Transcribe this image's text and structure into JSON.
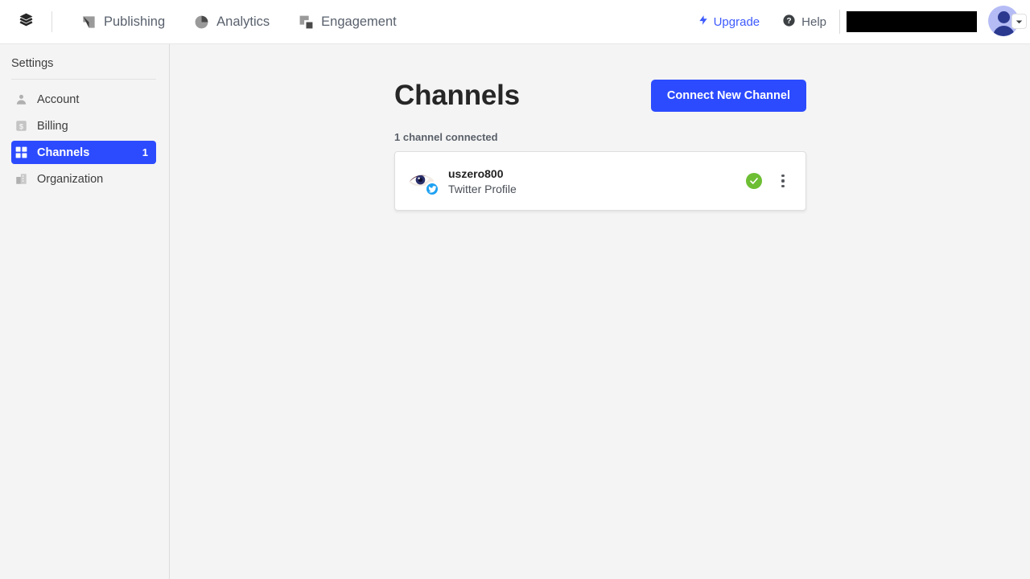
{
  "topbar": {
    "logo_icon": "layers-stack-icon",
    "nav": [
      {
        "label": "Publishing",
        "icon": "paper-plane-icon"
      },
      {
        "label": "Analytics",
        "icon": "pie-chart-icon"
      },
      {
        "label": "Engagement",
        "icon": "overlapping-squares-icon"
      }
    ],
    "upgrade_label": "Upgrade",
    "upgrade_icon": "lightning-bolt-icon",
    "help_label": "Help",
    "help_icon": "question-circle-icon",
    "redacted_field": "",
    "avatar_icon": "user-avatar",
    "caret_icon": "chevron-down-icon"
  },
  "sidebar": {
    "title": "Settings",
    "items": [
      {
        "label": "Account",
        "icon": "person-icon",
        "badge": "",
        "active": false
      },
      {
        "label": "Billing",
        "icon": "dollar-card-icon",
        "badge": "",
        "active": false
      },
      {
        "label": "Channels",
        "icon": "grid-squares-icon",
        "badge": "1",
        "active": true
      },
      {
        "label": "Organization",
        "icon": "building-icon",
        "badge": "",
        "active": false
      }
    ]
  },
  "main": {
    "page_title": "Channels",
    "connect_button": "Connect New Channel",
    "channel_count_label": "1 channel connected",
    "channels": [
      {
        "name": "uszero800",
        "type": "Twitter Profile",
        "avatar_icon": "eye-avatar-image",
        "network_badge_icon": "twitter-bird-icon",
        "status_icon": "green-check-icon",
        "menu_icon": "kebab-menu-icon"
      }
    ]
  },
  "colors": {
    "accent_blue": "#2c4bff",
    "link_blue": "#3d5afe",
    "status_green": "#6dbe33",
    "twitter_blue": "#1da1f2",
    "page_bg": "#f4f4f4"
  }
}
